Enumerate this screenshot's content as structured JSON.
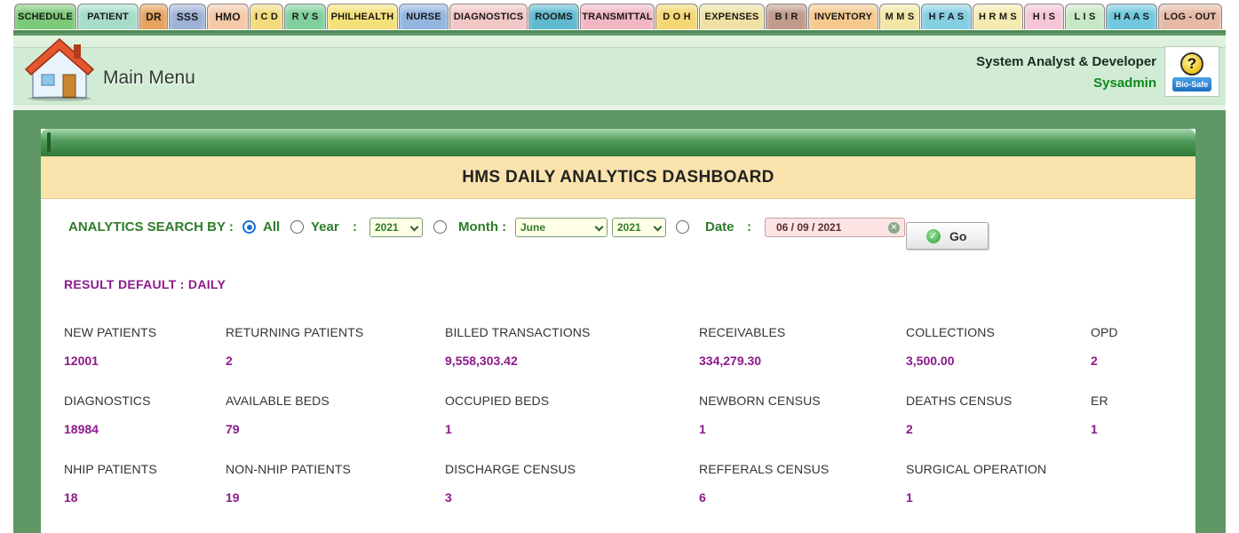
{
  "nav": {
    "tabs": [
      {
        "label": "SCHEDULE",
        "color": "#7cc97a"
      },
      {
        "label": "PATIENT",
        "color": "#a6dcc8"
      },
      {
        "label": "DR",
        "color": "#e7a25d"
      },
      {
        "label": "SSS",
        "color": "#9fb2d6"
      },
      {
        "label": "HMO",
        "color": "#f4c9a8"
      },
      {
        "label": "I C D",
        "color": "#f2dc7c"
      },
      {
        "label": "R V S",
        "color": "#7fcf9d"
      },
      {
        "label": "PHILHEALTH",
        "color": "#f5e17a"
      },
      {
        "label": "NURSE",
        "color": "#93b5df"
      },
      {
        "label": "DIAGNOSTICS",
        "color": "#f3c6c6"
      },
      {
        "label": "ROOMS",
        "color": "#5fb9cf"
      },
      {
        "label": "TRANSMITTAL",
        "color": "#f1b8c4"
      },
      {
        "label": "D O H",
        "color": "#f5d774"
      },
      {
        "label": "EXPENSES",
        "color": "#efe1a3"
      },
      {
        "label": "B I R",
        "color": "#c19a8a"
      },
      {
        "label": "INVENTORY",
        "color": "#f5c98e"
      },
      {
        "label": "M M S",
        "color": "#f3e7a6"
      },
      {
        "label": "H F A S",
        "color": "#86cfe3"
      },
      {
        "label": "H R M S",
        "color": "#f5eab0"
      },
      {
        "label": "H I S",
        "color": "#f4c6d6"
      },
      {
        "label": "L I S",
        "color": "#c7e8c5"
      },
      {
        "label": "H A A S",
        "color": "#71c8de"
      },
      {
        "label": "LOG - OUT",
        "color": "#e6b9a6"
      }
    ]
  },
  "header": {
    "title": "Main Menu",
    "role": "System Analyst & Developer",
    "username": "Sysadmin",
    "help_tag": "Bio-Safe",
    "help_symbol": "?"
  },
  "dashboard": {
    "title": "HMS DAILY ANALYTICS DASHBOARD",
    "search": {
      "label": "ANALYTICS SEARCH BY :",
      "options": {
        "all": "All",
        "year": "Year",
        "month": "Month :",
        "date": "Date"
      },
      "colon": ":",
      "year_value": "2021",
      "month_value": "June",
      "month_year_value": "2021",
      "date_value": "06 / 09 / 2021",
      "go_label": "Go"
    },
    "result_default": "RESULT DEFAULT  : DAILY",
    "metrics": [
      {
        "label": "NEW PATIENTS",
        "value": "12001"
      },
      {
        "label": "RETURNING PATIENTS",
        "value": "2"
      },
      {
        "label": "BILLED TRANSACTIONS",
        "value": "9,558,303.42"
      },
      {
        "label": "RECEIVABLES",
        "value": "334,279.30"
      },
      {
        "label": "COLLECTIONS",
        "value": "3,500.00"
      },
      {
        "label": "OPD",
        "value": "2"
      },
      {
        "label": "DIAGNOSTICS",
        "value": "18984"
      },
      {
        "label": "AVAILABLE BEDS",
        "value": "79"
      },
      {
        "label": "OCCUPIED BEDS",
        "value": "1"
      },
      {
        "label": "NEWBORN CENSUS",
        "value": "1"
      },
      {
        "label": "DEATHS CENSUS",
        "value": "2"
      },
      {
        "label": "ER",
        "value": "1"
      },
      {
        "label": "NHIP PATIENTS",
        "value": "18"
      },
      {
        "label": "NON-NHIP PATIENTS",
        "value": "19"
      },
      {
        "label": "DISCHARGE CENSUS",
        "value": "3"
      },
      {
        "label": "REFFERALS CENSUS",
        "value": "6"
      },
      {
        "label": "SURGICAL OPERATION",
        "value": "1"
      }
    ]
  }
}
